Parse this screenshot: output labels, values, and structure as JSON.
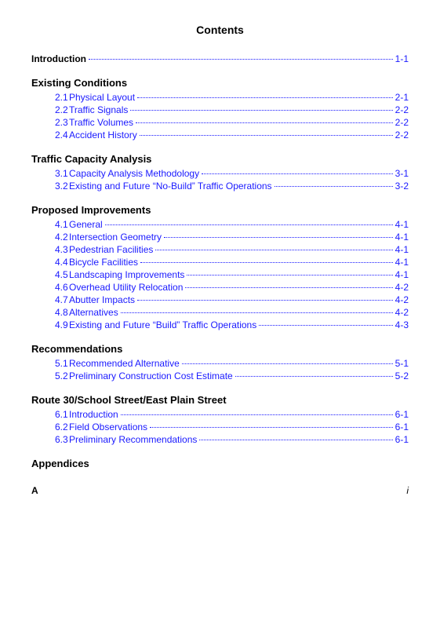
{
  "title": "Contents",
  "intro": {
    "label": "Introduction",
    "page": "1-1"
  },
  "sections": [
    {
      "header": "Existing Conditions",
      "items": [
        {
          "num": "2.1",
          "label": "Physical Layout",
          "page": "2-1"
        },
        {
          "num": "2.2",
          "label": "Traffic Signals",
          "page": "2-2"
        },
        {
          "num": "2.3",
          "label": "Traffic Volumes",
          "page": "2-2"
        },
        {
          "num": "2.4",
          "label": "Accident History",
          "page": "2-2"
        }
      ]
    },
    {
      "header": "Traffic Capacity Analysis",
      "items": [
        {
          "num": "3.1",
          "label": "Capacity Analysis Methodology",
          "page": "3-1"
        },
        {
          "num": "3.2",
          "label": "Existing and Future “No-Build” Traffic Operations",
          "page": "3-2"
        }
      ]
    },
    {
      "header": "Proposed Improvements",
      "items": [
        {
          "num": "4.1",
          "label": "General",
          "page": "4-1"
        },
        {
          "num": "4.2",
          "label": "Intersection Geometry",
          "page": "4-1"
        },
        {
          "num": "4.3",
          "label": "Pedestrian Facilities",
          "page": "4-1"
        },
        {
          "num": "4.4",
          "label": "Bicycle Facilities",
          "page": "4-1"
        },
        {
          "num": "4.5",
          "label": "Landscaping Improvements",
          "page": "4-1"
        },
        {
          "num": "4.6",
          "label": "Overhead Utility Relocation",
          "page": "4-2"
        },
        {
          "num": "4.7",
          "label": "Abutter Impacts",
          "page": "4-2"
        },
        {
          "num": "4.8",
          "label": "Alternatives",
          "page": "4-2"
        },
        {
          "num": "4.9",
          "label": "Existing and Future “Build” Traffic Operations",
          "page": "4-3"
        }
      ]
    },
    {
      "header": "Recommendations",
      "items": [
        {
          "num": "5.1",
          "label": "Recommended Alternative",
          "page": "5-1"
        },
        {
          "num": "5.2",
          "label": "Preliminary Construction Cost Estimate",
          "page": "5-2"
        }
      ]
    },
    {
      "header": "Route 30/School Street/East Plain Street",
      "items": [
        {
          "num": "6.1",
          "label": "Introduction",
          "page": "6-1"
        },
        {
          "num": "6.2",
          "label": "Field Observations",
          "page": "6-1"
        },
        {
          "num": "6.3",
          "label": "Preliminary Recommendations",
          "page": "6-1"
        }
      ]
    },
    {
      "header": "Appendices",
      "items": []
    }
  ],
  "footer": {
    "left": "A",
    "right": "i"
  }
}
